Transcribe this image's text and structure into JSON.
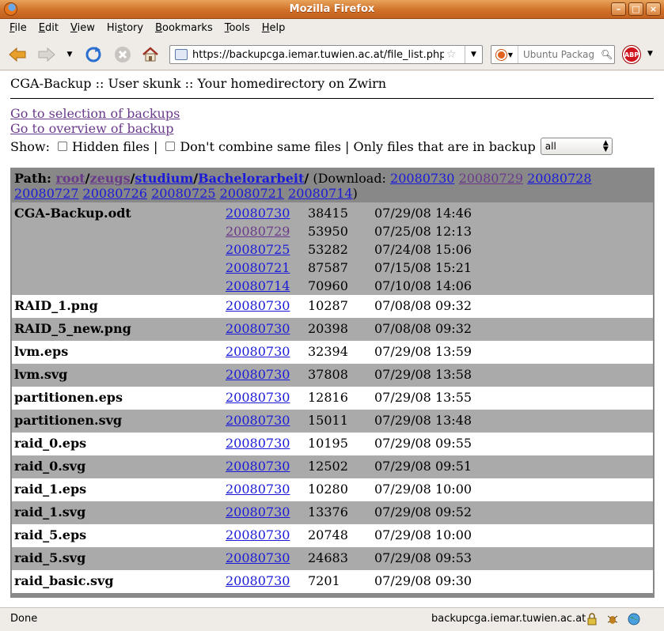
{
  "window": {
    "title": "Mozilla Firefox"
  },
  "menu": [
    "File",
    "Edit",
    "View",
    "History",
    "Bookmarks",
    "Tools",
    "Help"
  ],
  "menu_mnemonics": [
    "F",
    "E",
    "V",
    "s",
    "B",
    "T",
    "H"
  ],
  "nav": {
    "url": "https://backupcga.iemar.tuwien.ac.at/file_list.php?",
    "search_placeholder": "Ubuntu Packag",
    "abp_label": "ABP"
  },
  "page": {
    "header": "CGA-Backup :: User skunk :: Your homedirectory on Zwirn",
    "link_selection": "Go to selection of backups",
    "link_overview": "Go to overview of backup",
    "show_label": "Show:",
    "hidden_files": "Hidden files |",
    "dont_combine": "Don't combine same files | Only files that are in backup",
    "select_value": "all"
  },
  "path": {
    "label": "Path:",
    "parts": [
      "root",
      "zeugs",
      "studium",
      "Bachelorarbeit"
    ],
    "download_label": "(Download:",
    "downloads": [
      "20080730",
      "20080729",
      "20080728",
      "20080727",
      "20080726",
      "20080725",
      "20080721",
      "20080714"
    ],
    "close": ")"
  },
  "files": [
    {
      "name": "CGA-Backup.odt",
      "versions": [
        {
          "date_link": "20080730",
          "size": "38415",
          "mtime": "07/29/08 14:46"
        },
        {
          "date_link": "20080729",
          "size": "53950",
          "mtime": "07/25/08 12:13"
        },
        {
          "date_link": "20080725",
          "size": "53282",
          "mtime": "07/24/08 15:06"
        },
        {
          "date_link": "20080721",
          "size": "87587",
          "mtime": "07/15/08 15:21"
        },
        {
          "date_link": "20080714",
          "size": "70960",
          "mtime": "07/10/08 14:06"
        }
      ]
    },
    {
      "name": "RAID_1.png",
      "versions": [
        {
          "date_link": "20080730",
          "size": "10287",
          "mtime": "07/08/08 09:32"
        }
      ]
    },
    {
      "name": "RAID_5_new.png",
      "versions": [
        {
          "date_link": "20080730",
          "size": "20398",
          "mtime": "07/08/08 09:32"
        }
      ]
    },
    {
      "name": "lvm.eps",
      "versions": [
        {
          "date_link": "20080730",
          "size": "32394",
          "mtime": "07/29/08 13:59"
        }
      ]
    },
    {
      "name": "lvm.svg",
      "versions": [
        {
          "date_link": "20080730",
          "size": "37808",
          "mtime": "07/29/08 13:58"
        }
      ]
    },
    {
      "name": "partitionen.eps",
      "versions": [
        {
          "date_link": "20080730",
          "size": "12816",
          "mtime": "07/29/08 13:55"
        }
      ]
    },
    {
      "name": "partitionen.svg",
      "versions": [
        {
          "date_link": "20080730",
          "size": "15011",
          "mtime": "07/29/08 13:48"
        }
      ]
    },
    {
      "name": "raid_0.eps",
      "versions": [
        {
          "date_link": "20080730",
          "size": "10195",
          "mtime": "07/29/08 09:55"
        }
      ]
    },
    {
      "name": "raid_0.svg",
      "versions": [
        {
          "date_link": "20080730",
          "size": "12502",
          "mtime": "07/29/08 09:51"
        }
      ]
    },
    {
      "name": "raid_1.eps",
      "versions": [
        {
          "date_link": "20080730",
          "size": "10280",
          "mtime": "07/29/08 10:00"
        }
      ]
    },
    {
      "name": "raid_1.svg",
      "versions": [
        {
          "date_link": "20080730",
          "size": "13376",
          "mtime": "07/29/08 09:52"
        }
      ]
    },
    {
      "name": "raid_5.eps",
      "versions": [
        {
          "date_link": "20080730",
          "size": "20748",
          "mtime": "07/29/08 10:00"
        }
      ]
    },
    {
      "name": "raid_5.svg",
      "versions": [
        {
          "date_link": "20080730",
          "size": "24683",
          "mtime": "07/29/08 09:53"
        }
      ]
    },
    {
      "name": "raid_basic.svg",
      "versions": [
        {
          "date_link": "20080730",
          "size": "7201",
          "mtime": "07/29/08 09:30"
        }
      ]
    }
  ],
  "status": {
    "text": "Done",
    "host": "backupcga.iemar.tuwien.ac.at"
  },
  "colors": {
    "titlebar": "#d1712a",
    "link": "#1a1ad8",
    "visited": "#6a3a8a",
    "row_gray": "#aaaaaa",
    "frame": "#888888"
  },
  "icons": [
    "firefox-logo-icon",
    "back-icon",
    "forward-icon",
    "reload-icon",
    "stop-icon",
    "home-icon",
    "site-identity-icon",
    "bookmark-star-icon",
    "ubuntu-icon",
    "magnifier-icon",
    "adblock-icon",
    "lock-icon",
    "bug-icon",
    "globe-icon"
  ]
}
